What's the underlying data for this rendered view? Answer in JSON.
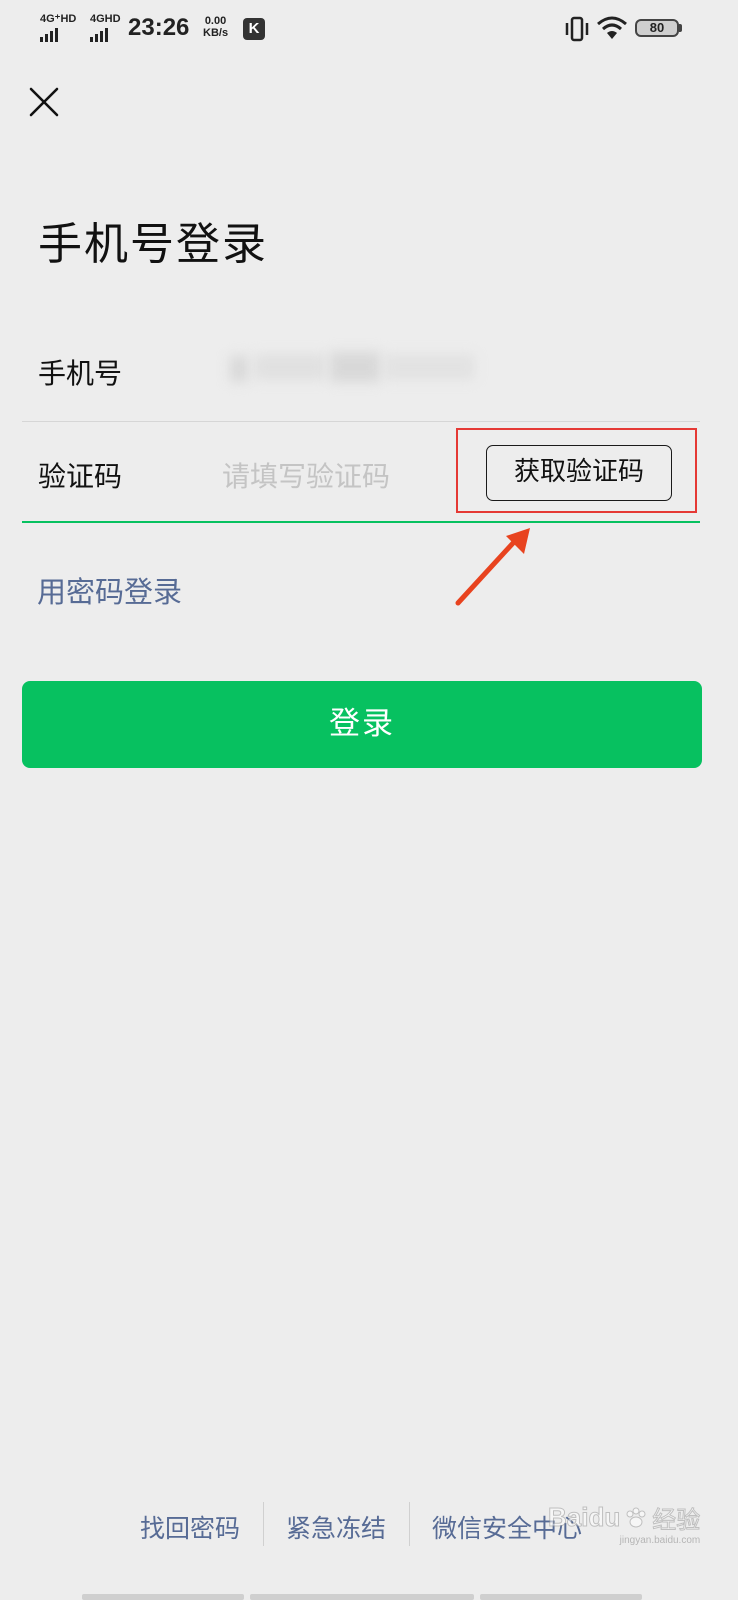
{
  "status_bar": {
    "net1": "4G⁺HD",
    "net2": "4GHD",
    "time": "23:26",
    "speed_value": "0.00",
    "speed_unit": "KB/s",
    "app_badge": "K",
    "battery": "80"
  },
  "header": {
    "title": "手机号登录"
  },
  "form": {
    "phone_label": "手机号",
    "code_label": "验证码",
    "code_placeholder": "请填写验证码",
    "get_code_button": "获取验证码"
  },
  "password_login_link": "用密码登录",
  "login_button": "登录",
  "footer": {
    "links": [
      "找回密码",
      "紧急冻结",
      "微信安全中心"
    ]
  },
  "watermark": {
    "brand": "Baidu",
    "suffix": "经验",
    "url": "jingyan.baidu.com"
  },
  "colors": {
    "accent_green": "#07c160",
    "link_blue": "#576b95",
    "annotation_red": "#e53935",
    "background": "#ededed"
  }
}
